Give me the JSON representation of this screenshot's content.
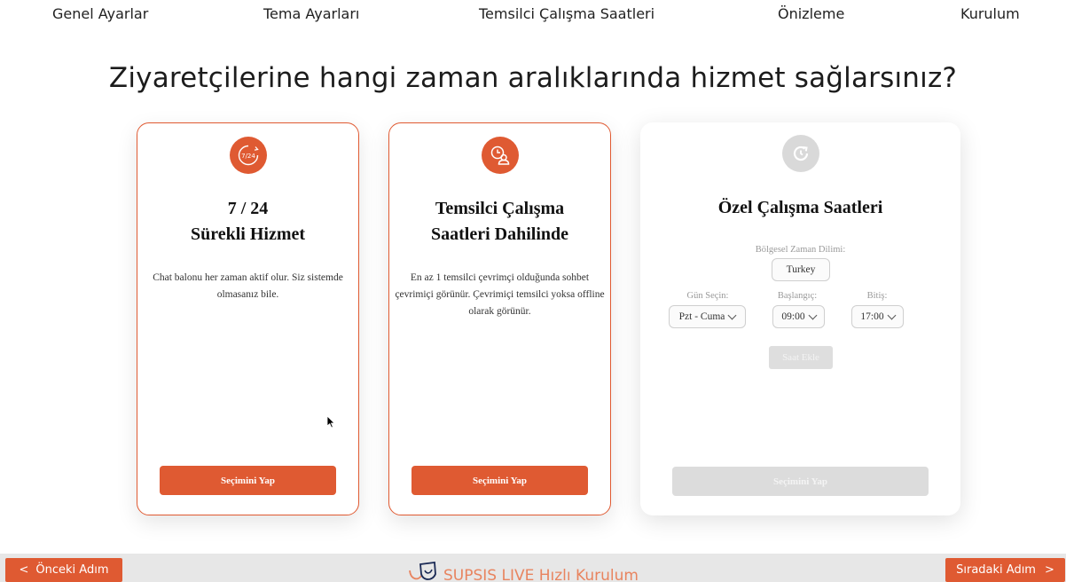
{
  "steps": [
    "Genel Ayarlar",
    "Tema Ayarları",
    "Temsilci Çalışma Saatleri",
    "Önizleme",
    "Kurulum"
  ],
  "headline": "Ziyaretçilerine hangi zaman aralıklarında hizmet sağlarsınız?",
  "cards": [
    {
      "icon": "clock-24-icon",
      "icon_text": "7/24",
      "title_line1": "7 / 24",
      "title_line2": "Sürekli Hizmet",
      "desc_line1": "Chat balonu her zaman aktif olur. Siz sistemde",
      "desc_line2": "olmasanız bile.",
      "button": "Seçimini Yap"
    },
    {
      "icon": "agent-clock-icon",
      "title_line1": "Temsilci Çalışma",
      "title_line2": "Saatleri Dahilinde",
      "desc_line1": "En az 1 temsilci çevrimçi olduğunda sohbet",
      "desc_line2": "çevrimiçi görünür. Çevrimiçi temsilci yoksa offline",
      "desc_line3": "olarak görünür.",
      "button": "Seçimini Yap"
    },
    {
      "icon": "custom-hours-icon",
      "title": "Özel Çalışma Saatleri",
      "timezone_label": "Bölgesel Zaman Dilimi:",
      "timezone_value": "Turkey",
      "day_label": "Gün Seçin:",
      "day_value": "Pzt - Cuma",
      "start_label": "Başlangıç:",
      "start_value": "09:00",
      "end_label": "Bitiş:",
      "end_value": "17:00",
      "add_button": "Saat Ekle",
      "button": "Seçimini Yap"
    }
  ],
  "footer": {
    "prev": "Önceki Adım",
    "next": "Sıradaki Adım",
    "brand": "SUPSIS LIVE Hızlı Kurulum",
    "accent": "#df5a32"
  }
}
